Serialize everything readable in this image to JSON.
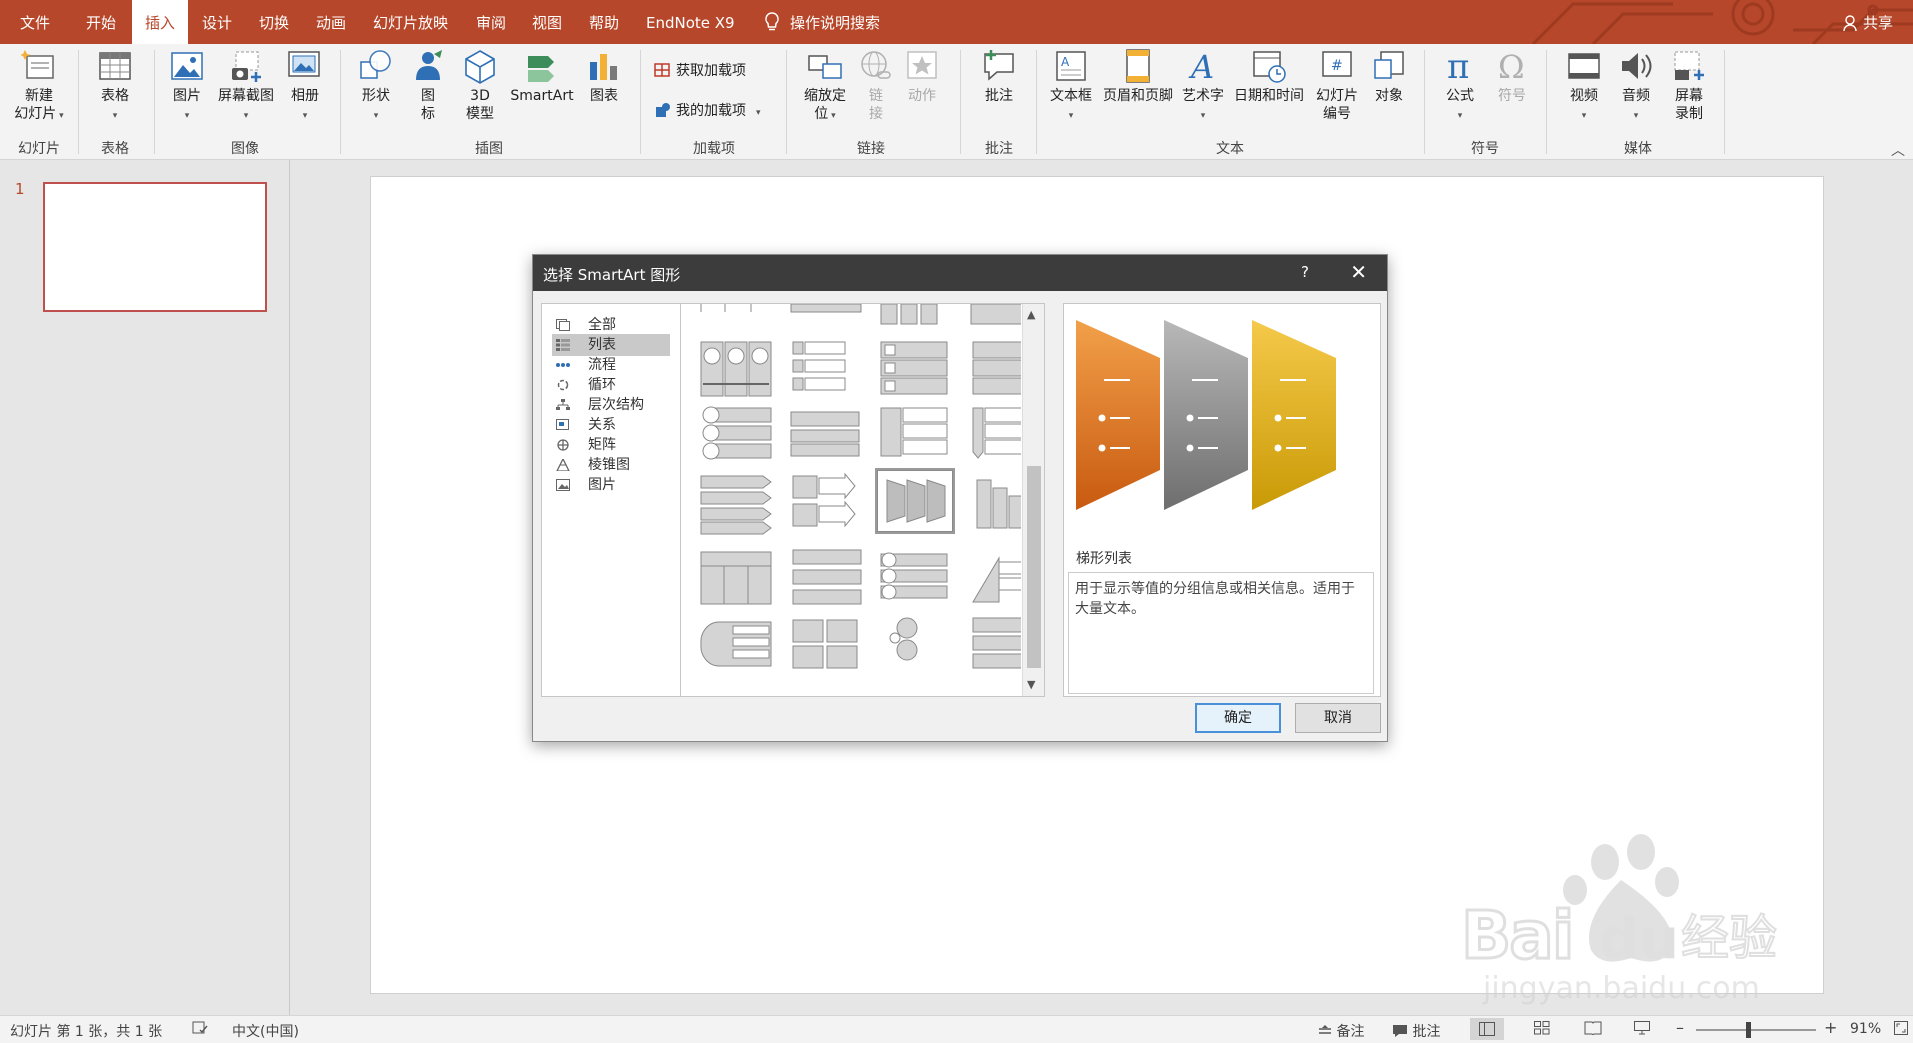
{
  "tabs": [
    {
      "label": "文件",
      "active": false
    },
    {
      "label": "开始",
      "active": false
    },
    {
      "label": "插入",
      "active": true
    },
    {
      "label": "设计",
      "active": false
    },
    {
      "label": "切换",
      "active": false
    },
    {
      "label": "动画",
      "active": false
    },
    {
      "label": "幻灯片放映",
      "active": false
    },
    {
      "label": "审阅",
      "active": false
    },
    {
      "label": "视图",
      "active": false
    },
    {
      "label": "帮助",
      "active": false
    },
    {
      "label": "EndNote X9",
      "active": false
    }
  ],
  "tell_me": "操作说明搜索",
  "share": "共享",
  "ribbon": {
    "new_slide": {
      "line1": "新建",
      "line2": "幻灯片"
    },
    "table": "表格",
    "picture": "图片",
    "screenshot": "屏幕截图",
    "album": "相册",
    "shapes": "形状",
    "icons": {
      "line1": "图",
      "line2": "标"
    },
    "model3d": {
      "line1": "3D",
      "line2": "模型"
    },
    "smartart": "SmartArt",
    "chart": "图表",
    "get_addins": "获取加载项",
    "my_addins": "我的加载项",
    "zoom": {
      "line1": "缩放定",
      "line2": "位"
    },
    "link": {
      "line1": "链",
      "line2": "接"
    },
    "action": "动作",
    "comment": "批注",
    "textbox": "文本框",
    "header_footer": "页眉和页脚",
    "wordart": "艺术字",
    "datetime": "日期和时间",
    "slide_number": {
      "line1": "幻灯片",
      "line2": "编号"
    },
    "object": "对象",
    "equation": "公式",
    "symbol": "符号",
    "video": "视频",
    "audio": "音频",
    "screen_record": {
      "line1": "屏幕",
      "line2": "录制"
    },
    "groups": {
      "slides": "幻灯片",
      "tables": "表格",
      "images": "图像",
      "illustrations": "插图",
      "addins": "加载项",
      "links": "链接",
      "comments": "批注",
      "text": "文本",
      "symbols": "符号",
      "media": "媒体"
    }
  },
  "thumbs": {
    "slide_number": "1"
  },
  "dialog": {
    "title": "选择 SmartArt 图形",
    "help": "?",
    "categories": [
      {
        "label": "全部",
        "icon": "all-icon",
        "selected": false
      },
      {
        "label": "列表",
        "icon": "list-icon",
        "selected": true
      },
      {
        "label": "流程",
        "icon": "process-icon",
        "selected": false
      },
      {
        "label": "循环",
        "icon": "cycle-icon",
        "selected": false
      },
      {
        "label": "层次结构",
        "icon": "hierarchy-icon",
        "selected": false
      },
      {
        "label": "关系",
        "icon": "relationship-icon",
        "selected": false
      },
      {
        "label": "矩阵",
        "icon": "matrix-icon",
        "selected": false
      },
      {
        "label": "棱锥图",
        "icon": "pyramid-icon",
        "selected": false
      },
      {
        "label": "图片",
        "icon": "picture-icon",
        "selected": false
      }
    ],
    "preview_title": "梯形列表",
    "preview_desc": "用于显示等值的分组信息或相关信息。适用于大量文本。",
    "ok": "确定",
    "cancel": "取消"
  },
  "status": {
    "slide_info": "幻灯片 第 1 张，共 1 张",
    "language": "中文(中国)",
    "notes": "备注",
    "comments": "批注",
    "zoom": "91%"
  },
  "watermark": {
    "brand": "Baidu经验",
    "url": "jingyan.baidu.com"
  },
  "colors": {
    "accent": "#b7472a",
    "orange": "#e87722",
    "gray": "#8c8c8c",
    "gold": "#e6b422"
  }
}
